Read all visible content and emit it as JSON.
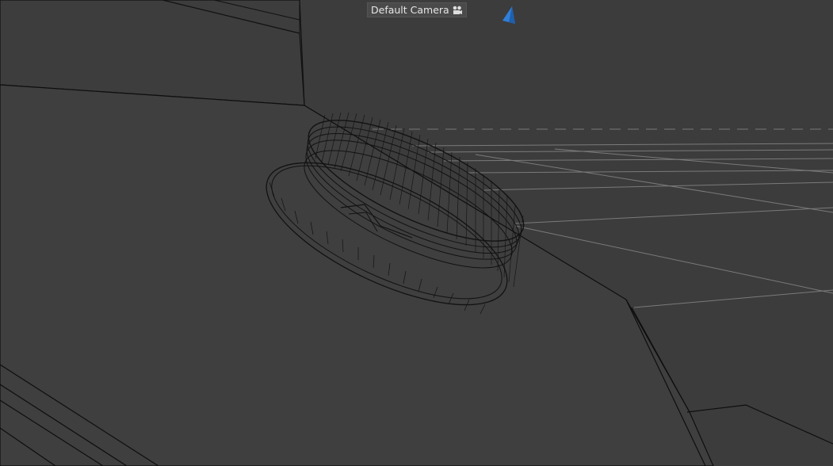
{
  "viewport": {
    "camera_label": "Default Camera",
    "camera_icon": "camera-icon",
    "nav_icon": "view-cone-icon",
    "colors": {
      "background": "#3c3c3c",
      "floor": "#3e3e3e",
      "grid_line": "#7a7a7a",
      "wire": "#141414",
      "accent_blue": "#2f7fd6"
    }
  }
}
